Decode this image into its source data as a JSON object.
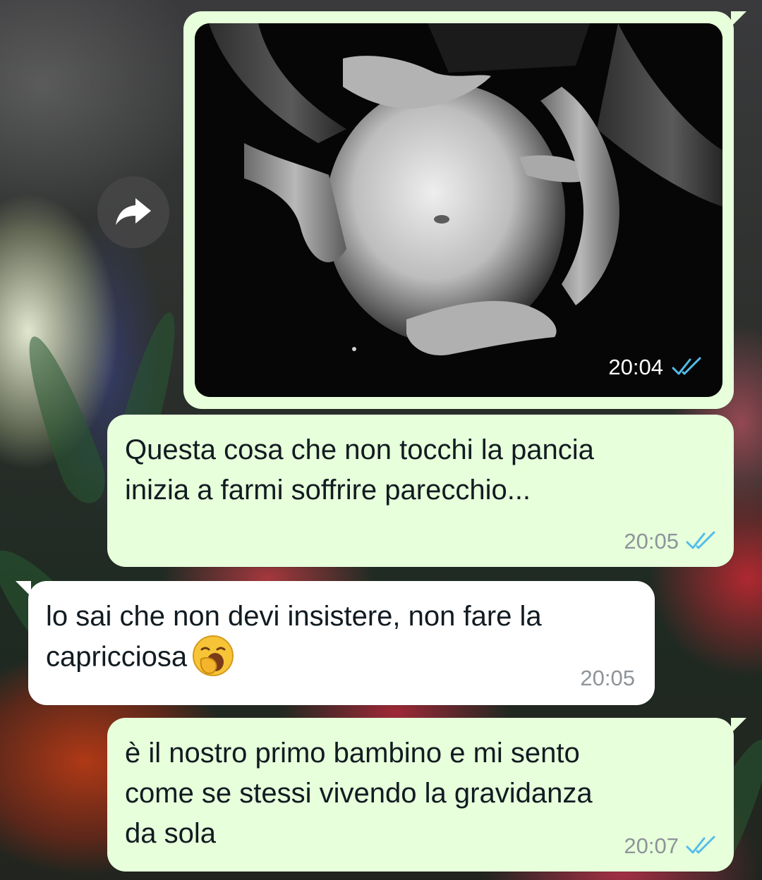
{
  "conversation": {
    "messages": [
      {
        "direction": "outgoing",
        "type": "image",
        "time": "20:04",
        "status_icon": "double-check-read-icon"
      },
      {
        "direction": "outgoing",
        "type": "text",
        "text": "Questa cosa che non tocchi la pancia\ninizia a farmi soffrire parecchio...",
        "time": "20:05",
        "status_icon": "double-check-read-icon"
      },
      {
        "direction": "incoming",
        "type": "text",
        "text": "lo sai che non devi insistere, non fare la\ncapricciosa",
        "emoji": "yawning-face-emoji",
        "time": "20:05"
      },
      {
        "direction": "outgoing",
        "type": "text",
        "text": "è il nostro primo bambino e mi sento\ncome se stessi vivendo la gravidanza\nda sola",
        "time": "20:07",
        "status_icon": "double-check-read-icon"
      }
    ]
  },
  "colors": {
    "outgoing_bubble": "#e7ffdb",
    "incoming_bubble": "#ffffff",
    "read_ticks": "#53bdeb",
    "timestamp": "#8d9498"
  },
  "icons": {
    "forward": "forward-arrow-icon",
    "read_receipt": "double-check-read-icon"
  }
}
